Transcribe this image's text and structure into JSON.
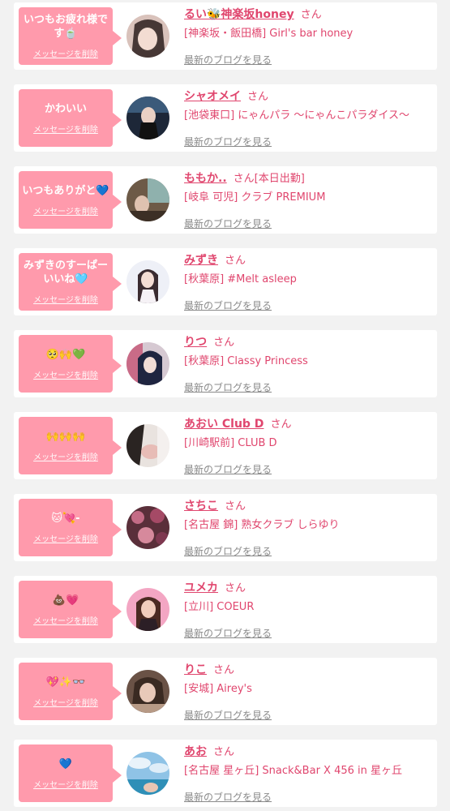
{
  "delete_label": "メッセージを削除",
  "honorific": "さん",
  "blog_label": "最新のブログを見る",
  "items": [
    {
      "message": "いつもお疲れ様です🍵",
      "name": "るい🐝神楽坂honey",
      "extra": "",
      "shop": "[神楽坂・飯田橋] Girl's bar honey"
    },
    {
      "message": "かわいい",
      "name": "シャオメイ",
      "extra": "",
      "shop": "[池袋東口] にゃんパラ 〜にゃんこパラダイス〜"
    },
    {
      "message": "いつもありがと💙",
      "name": "ももか..",
      "extra": "[本日出勤]",
      "shop": "[岐阜 可児] クラブ PREMIUM"
    },
    {
      "message": "みずきのすーぱーいいね🩵",
      "name": "みずき",
      "extra": "",
      "shop": "[秋葉原] #Melt asleep"
    },
    {
      "message": "🥺🙌💚",
      "name": "りつ",
      "extra": "",
      "shop": "[秋葉原] Classy Princess"
    },
    {
      "message": "🙌🙌🙌",
      "name": "あおい Club D",
      "extra": "",
      "shop": "[川崎駅前] CLUB D"
    },
    {
      "message": "🐱💘-",
      "name": "さちこ",
      "extra": "",
      "shop": "[名古屋 錦] 熟女クラブ しらゆり"
    },
    {
      "message": "💩💗",
      "name": "ユメカ",
      "extra": "",
      "shop": "[立川] COEUR"
    },
    {
      "message": "💖✨👓",
      "name": "りこ",
      "extra": "",
      "shop": "[安城] Airey's"
    },
    {
      "message": "💙",
      "name": "あお",
      "extra": "",
      "shop": "[名古屋 星ヶ丘] Snack&Bar X 456 in 星ヶ丘"
    }
  ]
}
